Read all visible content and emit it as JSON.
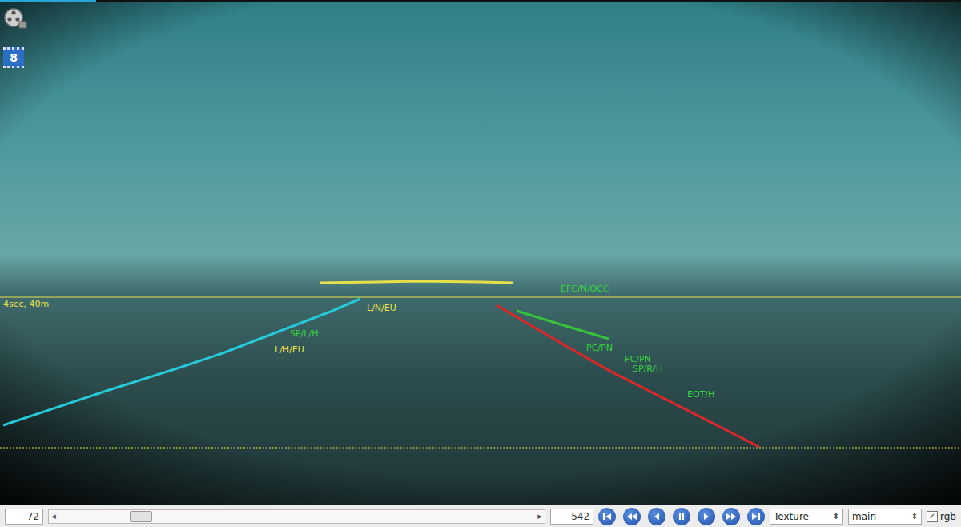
{
  "progress": {
    "level": 0.1
  },
  "frame_badge": "8",
  "overlay": {
    "horizon_label": "4sec, 40m",
    "horizon_color": "#e8e04a"
  },
  "lanes": [
    {
      "color": "#27c8d8"
    },
    {
      "color": "#e02626"
    },
    {
      "color": "#36c23a"
    },
    {
      "color": "#e8e04a"
    }
  ],
  "labels": [
    {
      "text": "SP/L/H",
      "color": "#36d23a"
    },
    {
      "text": "L/H/EU",
      "color": "#e8e04a"
    },
    {
      "text": "L/N/EU",
      "color": "#e8e04a"
    },
    {
      "text": "EFC/N/OCC",
      "color": "#36d23a"
    },
    {
      "text": "PC/PN",
      "color": "#36d23a"
    },
    {
      "text": "PC/PN",
      "color": "#36d23a"
    },
    {
      "text": "SP/R/H",
      "color": "#36d23a"
    },
    {
      "text": "EOT/H",
      "color": "#36d23a"
    }
  ],
  "controls": {
    "start_frame": "72",
    "slider_level": 0.15,
    "end_frame": "542",
    "buttons": [
      {
        "kind": "first"
      },
      {
        "kind": "rewind"
      },
      {
        "kind": "back"
      },
      {
        "kind": "pause"
      },
      {
        "kind": "play"
      },
      {
        "kind": "forward"
      },
      {
        "kind": "last"
      }
    ],
    "render_mode": "Texture",
    "view": "main",
    "rgb": {
      "label": "rgb",
      "checked": true
    }
  }
}
